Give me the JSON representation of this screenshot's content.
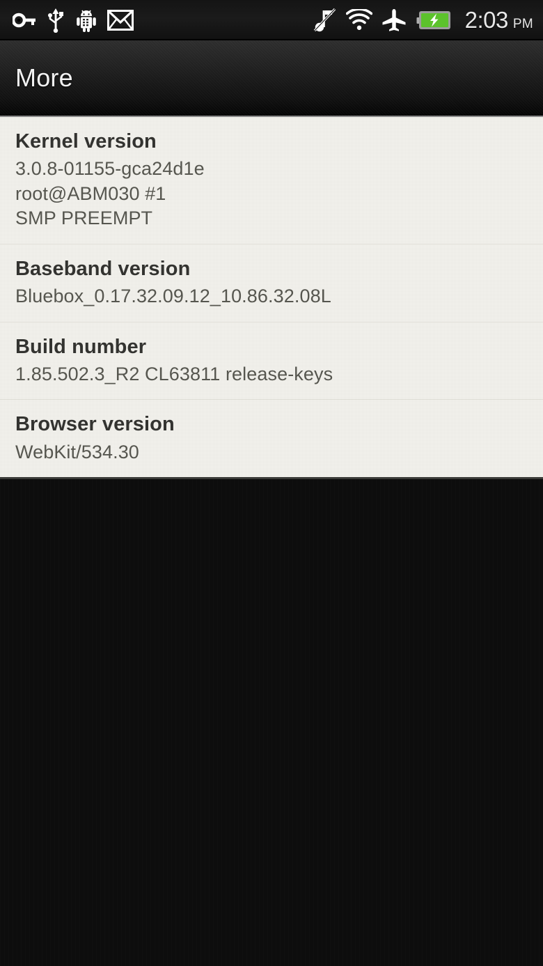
{
  "statusbar": {
    "left_icons": [
      {
        "name": "vpn-key-icon",
        "label": "VPN key"
      },
      {
        "name": "usb-icon",
        "label": "USB connected"
      },
      {
        "name": "android-debug-icon",
        "label": "USB debugging"
      },
      {
        "name": "gmail-icon",
        "label": "New Gmail"
      }
    ],
    "right_icons": [
      {
        "name": "silent-mode-icon",
        "label": "Silent mode"
      },
      {
        "name": "wifi-icon",
        "label": "Wi-Fi"
      },
      {
        "name": "airplane-mode-icon",
        "label": "Airplane mode"
      },
      {
        "name": "battery-charging-icon",
        "label": "Battery charging"
      }
    ],
    "clock": {
      "time": "2:03",
      "ampm": "PM"
    },
    "colors": {
      "battery_fill": "#5cc22c",
      "icon": "#ffffff",
      "text": "#e8e8e8"
    }
  },
  "header": {
    "title": "More"
  },
  "main": {
    "items": [
      {
        "title": "Kernel version",
        "summary_lines": [
          "3.0.8-01155-gca24d1e",
          "root@ABM030 #1",
          "SMP PREEMPT"
        ]
      },
      {
        "title": "Baseband version",
        "summary_lines": [
          "Bluebox_0.17.32.09.12_10.86.32.08L"
        ]
      },
      {
        "title": "Build number",
        "summary_lines": [
          "1.85.502.3_R2 CL63811 release-keys"
        ]
      },
      {
        "title": "Browser version",
        "summary_lines": [
          "WebKit/534.30"
        ]
      }
    ]
  },
  "theme": {
    "content_bg": "#f2f1ec",
    "page_bg": "#0d0d0d",
    "title_text": "#333330",
    "summary_text": "#56564f",
    "divider": "#e0ded7"
  }
}
